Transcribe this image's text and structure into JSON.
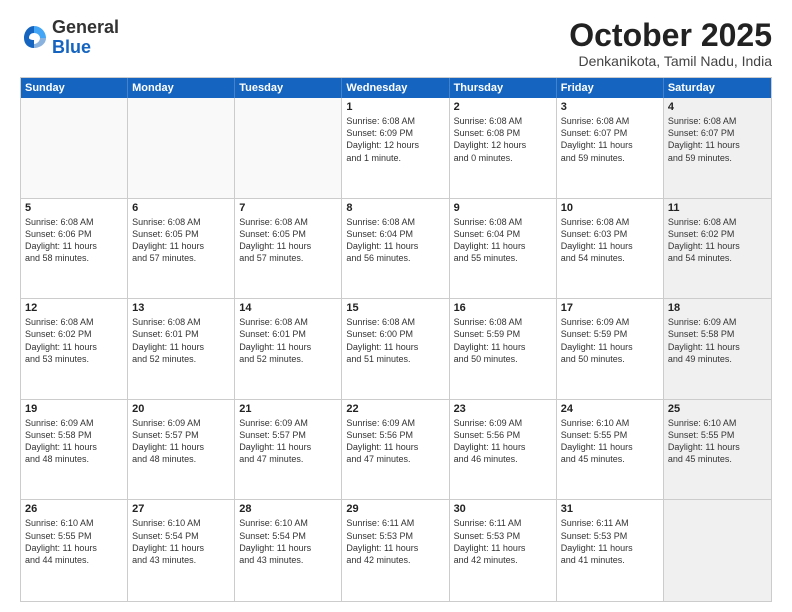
{
  "header": {
    "logo_general": "General",
    "logo_blue": "Blue",
    "month_title": "October 2025",
    "location": "Denkanikota, Tamil Nadu, India"
  },
  "weekdays": [
    "Sunday",
    "Monday",
    "Tuesday",
    "Wednesday",
    "Thursday",
    "Friday",
    "Saturday"
  ],
  "rows": [
    [
      {
        "day": "",
        "lines": [],
        "empty": true
      },
      {
        "day": "",
        "lines": [],
        "empty": true
      },
      {
        "day": "",
        "lines": [],
        "empty": true
      },
      {
        "day": "1",
        "lines": [
          "Sunrise: 6:08 AM",
          "Sunset: 6:09 PM",
          "Daylight: 12 hours",
          "and 1 minute."
        ],
        "empty": false
      },
      {
        "day": "2",
        "lines": [
          "Sunrise: 6:08 AM",
          "Sunset: 6:08 PM",
          "Daylight: 12 hours",
          "and 0 minutes."
        ],
        "empty": false
      },
      {
        "day": "3",
        "lines": [
          "Sunrise: 6:08 AM",
          "Sunset: 6:07 PM",
          "Daylight: 11 hours",
          "and 59 minutes."
        ],
        "empty": false
      },
      {
        "day": "4",
        "lines": [
          "Sunrise: 6:08 AM",
          "Sunset: 6:07 PM",
          "Daylight: 11 hours",
          "and 59 minutes."
        ],
        "empty": false,
        "shaded": true
      }
    ],
    [
      {
        "day": "5",
        "lines": [
          "Sunrise: 6:08 AM",
          "Sunset: 6:06 PM",
          "Daylight: 11 hours",
          "and 58 minutes."
        ],
        "empty": false
      },
      {
        "day": "6",
        "lines": [
          "Sunrise: 6:08 AM",
          "Sunset: 6:05 PM",
          "Daylight: 11 hours",
          "and 57 minutes."
        ],
        "empty": false
      },
      {
        "day": "7",
        "lines": [
          "Sunrise: 6:08 AM",
          "Sunset: 6:05 PM",
          "Daylight: 11 hours",
          "and 57 minutes."
        ],
        "empty": false
      },
      {
        "day": "8",
        "lines": [
          "Sunrise: 6:08 AM",
          "Sunset: 6:04 PM",
          "Daylight: 11 hours",
          "and 56 minutes."
        ],
        "empty": false
      },
      {
        "day": "9",
        "lines": [
          "Sunrise: 6:08 AM",
          "Sunset: 6:04 PM",
          "Daylight: 11 hours",
          "and 55 minutes."
        ],
        "empty": false
      },
      {
        "day": "10",
        "lines": [
          "Sunrise: 6:08 AM",
          "Sunset: 6:03 PM",
          "Daylight: 11 hours",
          "and 54 minutes."
        ],
        "empty": false
      },
      {
        "day": "11",
        "lines": [
          "Sunrise: 6:08 AM",
          "Sunset: 6:02 PM",
          "Daylight: 11 hours",
          "and 54 minutes."
        ],
        "empty": false,
        "shaded": true
      }
    ],
    [
      {
        "day": "12",
        "lines": [
          "Sunrise: 6:08 AM",
          "Sunset: 6:02 PM",
          "Daylight: 11 hours",
          "and 53 minutes."
        ],
        "empty": false
      },
      {
        "day": "13",
        "lines": [
          "Sunrise: 6:08 AM",
          "Sunset: 6:01 PM",
          "Daylight: 11 hours",
          "and 52 minutes."
        ],
        "empty": false
      },
      {
        "day": "14",
        "lines": [
          "Sunrise: 6:08 AM",
          "Sunset: 6:01 PM",
          "Daylight: 11 hours",
          "and 52 minutes."
        ],
        "empty": false
      },
      {
        "day": "15",
        "lines": [
          "Sunrise: 6:08 AM",
          "Sunset: 6:00 PM",
          "Daylight: 11 hours",
          "and 51 minutes."
        ],
        "empty": false
      },
      {
        "day": "16",
        "lines": [
          "Sunrise: 6:08 AM",
          "Sunset: 5:59 PM",
          "Daylight: 11 hours",
          "and 50 minutes."
        ],
        "empty": false
      },
      {
        "day": "17",
        "lines": [
          "Sunrise: 6:09 AM",
          "Sunset: 5:59 PM",
          "Daylight: 11 hours",
          "and 50 minutes."
        ],
        "empty": false
      },
      {
        "day": "18",
        "lines": [
          "Sunrise: 6:09 AM",
          "Sunset: 5:58 PM",
          "Daylight: 11 hours",
          "and 49 minutes."
        ],
        "empty": false,
        "shaded": true
      }
    ],
    [
      {
        "day": "19",
        "lines": [
          "Sunrise: 6:09 AM",
          "Sunset: 5:58 PM",
          "Daylight: 11 hours",
          "and 48 minutes."
        ],
        "empty": false
      },
      {
        "day": "20",
        "lines": [
          "Sunrise: 6:09 AM",
          "Sunset: 5:57 PM",
          "Daylight: 11 hours",
          "and 48 minutes."
        ],
        "empty": false
      },
      {
        "day": "21",
        "lines": [
          "Sunrise: 6:09 AM",
          "Sunset: 5:57 PM",
          "Daylight: 11 hours",
          "and 47 minutes."
        ],
        "empty": false
      },
      {
        "day": "22",
        "lines": [
          "Sunrise: 6:09 AM",
          "Sunset: 5:56 PM",
          "Daylight: 11 hours",
          "and 47 minutes."
        ],
        "empty": false
      },
      {
        "day": "23",
        "lines": [
          "Sunrise: 6:09 AM",
          "Sunset: 5:56 PM",
          "Daylight: 11 hours",
          "and 46 minutes."
        ],
        "empty": false
      },
      {
        "day": "24",
        "lines": [
          "Sunrise: 6:10 AM",
          "Sunset: 5:55 PM",
          "Daylight: 11 hours",
          "and 45 minutes."
        ],
        "empty": false
      },
      {
        "day": "25",
        "lines": [
          "Sunrise: 6:10 AM",
          "Sunset: 5:55 PM",
          "Daylight: 11 hours",
          "and 45 minutes."
        ],
        "empty": false,
        "shaded": true
      }
    ],
    [
      {
        "day": "26",
        "lines": [
          "Sunrise: 6:10 AM",
          "Sunset: 5:55 PM",
          "Daylight: 11 hours",
          "and 44 minutes."
        ],
        "empty": false
      },
      {
        "day": "27",
        "lines": [
          "Sunrise: 6:10 AM",
          "Sunset: 5:54 PM",
          "Daylight: 11 hours",
          "and 43 minutes."
        ],
        "empty": false
      },
      {
        "day": "28",
        "lines": [
          "Sunrise: 6:10 AM",
          "Sunset: 5:54 PM",
          "Daylight: 11 hours",
          "and 43 minutes."
        ],
        "empty": false
      },
      {
        "day": "29",
        "lines": [
          "Sunrise: 6:11 AM",
          "Sunset: 5:53 PM",
          "Daylight: 11 hours",
          "and 42 minutes."
        ],
        "empty": false
      },
      {
        "day": "30",
        "lines": [
          "Sunrise: 6:11 AM",
          "Sunset: 5:53 PM",
          "Daylight: 11 hours",
          "and 42 minutes."
        ],
        "empty": false
      },
      {
        "day": "31",
        "lines": [
          "Sunrise: 6:11 AM",
          "Sunset: 5:53 PM",
          "Daylight: 11 hours",
          "and 41 minutes."
        ],
        "empty": false
      },
      {
        "day": "",
        "lines": [],
        "empty": true,
        "shaded": true
      }
    ]
  ]
}
